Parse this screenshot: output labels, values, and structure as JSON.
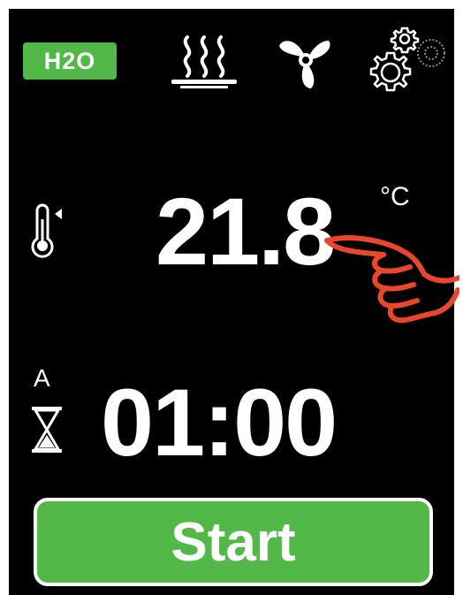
{
  "header": {
    "badge_label": "H2O",
    "icons": [
      "steam-icon",
      "fan-icon",
      "settings-gears-icon"
    ]
  },
  "temperature": {
    "value": "21.8",
    "unit": "°C",
    "icon": "thermometer-icon"
  },
  "timer": {
    "mode": "A",
    "value": "01:00",
    "icon": "hourglass-icon"
  },
  "start_button": {
    "label": "Start"
  },
  "colors": {
    "accent": "#52b848",
    "background": "#000000",
    "pointer": "#e8472b"
  }
}
